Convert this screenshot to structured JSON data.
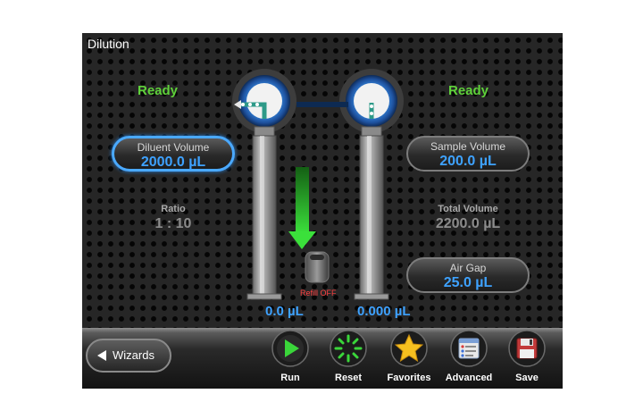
{
  "screen": {
    "title": "Dilution"
  },
  "left_syringe": {
    "status": "Ready",
    "volume": "0.0 µL"
  },
  "right_syringe": {
    "status": "Ready",
    "volume": "0.000 µL"
  },
  "diluent_volume": {
    "label": "Diluent Volume",
    "value": "2000.0 µL"
  },
  "sample_volume": {
    "label": "Sample Volume",
    "value": "200.0 µL"
  },
  "ratio": {
    "label": "Ratio",
    "value": "1 : 10"
  },
  "total_volume": {
    "label": "Total Volume",
    "value": "2200.0 µL"
  },
  "air_gap": {
    "label": "Air Gap",
    "value": "25.0 µL"
  },
  "refill": {
    "label": "Refill OFF"
  },
  "toolbar": {
    "wizards_label": "Wizards",
    "run_label": "Run",
    "reset_label": "Reset",
    "favorites_label": "Favorites",
    "advanced_label": "Advanced",
    "save_label": "Save"
  },
  "icons": {
    "run": "play-icon",
    "reset": "reset-icon",
    "favorites": "star-icon",
    "advanced": "advanced-settings-icon",
    "save": "floppy-disk-icon",
    "wizards": "back-arrow-icon"
  },
  "colors": {
    "ready": "#5fd23a",
    "value_blue": "#3ea2ff",
    "refill_red": "#ff4242",
    "flow_arrow": "#2fc82f"
  }
}
